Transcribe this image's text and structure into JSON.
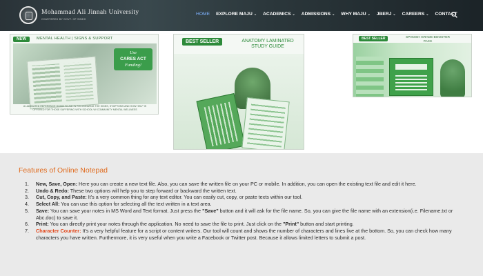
{
  "header": {
    "university_name": "Mohammad Ali Jinnah University",
    "university_subtitle": "CHARTERED BY GOVT. OF SINDH",
    "nav": [
      {
        "label": "HOME",
        "active": true,
        "dropdown": false
      },
      {
        "label": "EXPLORE MAJU",
        "active": false,
        "dropdown": true
      },
      {
        "label": "ACADEMICS",
        "active": false,
        "dropdown": true
      },
      {
        "label": "ADMISSIONS",
        "active": false,
        "dropdown": true
      },
      {
        "label": "WHY MAJU",
        "active": false,
        "dropdown": true
      },
      {
        "label": "JBERJ",
        "active": false,
        "dropdown": true
      },
      {
        "label": "CAREERS",
        "active": false,
        "dropdown": true
      },
      {
        "label": "CONTACT",
        "active": false,
        "dropdown": false
      }
    ],
    "search_icon": "search-icon"
  },
  "banners": {
    "b1": {
      "tag": "NEW",
      "title": "MENTAL HEALTH | SIGNS & SUPPORT",
      "badge_line1": "Use",
      "badge_line2": "CARES ACT",
      "badge_line3": "Funding!",
      "caption": "A LAMINATED REFERENCE GUIDE TO AID IN RECOGNIZING THE SIGNS, SYMPTOMS AND HOW HELP IS OFFERED FOR THOSE SUFFERING WITH SCHOOL W/ COMMUNITY MENTAL WELLNESS"
    },
    "b2": {
      "tag": "BEST SELLER",
      "title": "ANATOMY LAMINATED STUDY GUIDE"
    },
    "b3": {
      "tag": "BEST SELLER",
      "title": "SPANISH GRADE BOOSTER PACK"
    }
  },
  "features": {
    "heading": "Features of Online Notepad",
    "items": [
      {
        "num": "1.",
        "parts": [
          {
            "t": "New, Save, Open:",
            "s": "b"
          },
          {
            "t": " Here you can create a new text file. Also, you can save the written file on your PC or mobile. In addition, you can open the existing text file and edit it here.",
            "s": "n"
          }
        ]
      },
      {
        "num": "2.",
        "parts": [
          {
            "t": "Undo & Redo:",
            "s": "b"
          },
          {
            "t": " These two options will help you to step forward or backward the written text.",
            "s": "n"
          }
        ]
      },
      {
        "num": "3.",
        "parts": [
          {
            "t": "Cut, Copy, and Paste:",
            "s": "b"
          },
          {
            "t": " It's a very common thing for any text editor. You can easily cut, copy, or paste texts within our tool.",
            "s": "n"
          }
        ]
      },
      {
        "num": "4.",
        "parts": [
          {
            "t": "Select All:",
            "s": "b"
          },
          {
            "t": " You can use this option for selecting all the text written in a text area.",
            "s": "n"
          }
        ]
      },
      {
        "num": "5.",
        "parts": [
          {
            "t": "Save:",
            "s": "b"
          },
          {
            "t": " You can save your notes in MS Word and Text format. Just press the ",
            "s": "n"
          },
          {
            "t": "\"Save\"",
            "s": "b"
          },
          {
            "t": " button and it will ask for the file name. So, you can give the file name with an extension(i.e. Filename.txt or Abc.doc) to save it.",
            "s": "n"
          }
        ]
      },
      {
        "num": "6.",
        "parts": [
          {
            "t": "Print:",
            "s": "b"
          },
          {
            "t": " You can directly print your notes through the application. No need to save the file to print. Just click on the ",
            "s": "n"
          },
          {
            "t": "\"Print\"",
            "s": "b"
          },
          {
            "t": " button and start printing.",
            "s": "n"
          }
        ]
      },
      {
        "num": "7.",
        "parts": [
          {
            "t": "Character Counter:",
            "s": "hl"
          },
          {
            "t": " It's a very helpful feature for a script or content writers. Our tool will count and shows the number of characters and lines live at the bottom. So, you can check how many characters you have written. Furthermore, it is very useful when you write a Facebook or Twitter post. Because it allows limited letters to submit a post.",
            "s": "n"
          }
        ]
      }
    ]
  },
  "colors": {
    "nav_bg": "#1f2a30",
    "nav_active": "#7fb3ff",
    "heading_orange": "#e06a1c",
    "highlight_red": "#e2471b",
    "banner_green": "#2d8a3a",
    "section_bg": "#eaeaea"
  }
}
